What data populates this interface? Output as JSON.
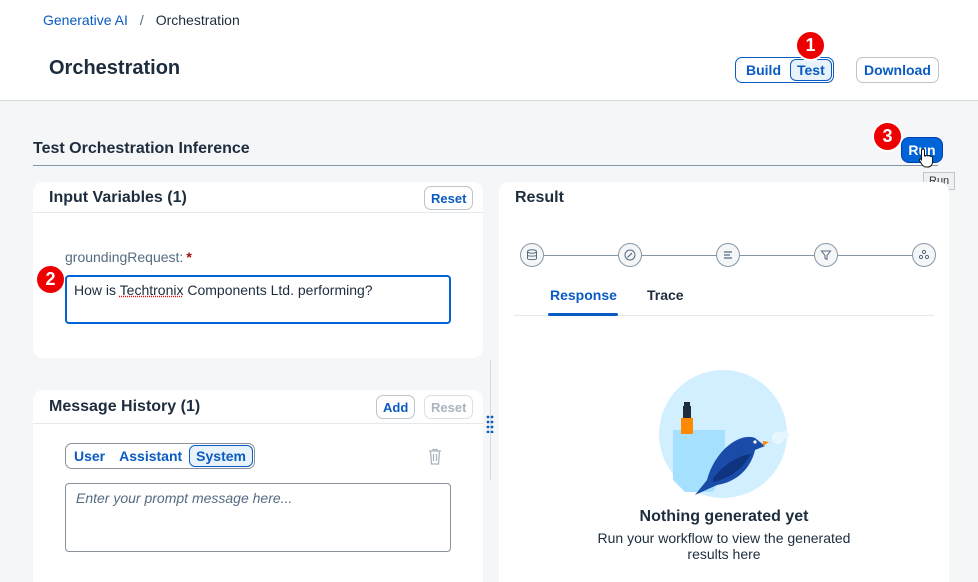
{
  "breadcrumb": {
    "parent": "Generative AI",
    "separator": "/",
    "current": "Orchestration"
  },
  "page_title": "Orchestration",
  "mode_toggle": {
    "build": "Build",
    "test": "Test",
    "active": "Test"
  },
  "download_label": "Download",
  "badges": {
    "b1": "1",
    "b2": "2",
    "b3": "3"
  },
  "section": {
    "title": "Test Orchestration Inference",
    "run_label": "Run",
    "run_tooltip": "Run"
  },
  "input_variables": {
    "title": "Input Variables (1)",
    "reset_label": "Reset",
    "field_label": "groundingRequest:",
    "required_mark": "*",
    "value_prefix": "How is ",
    "value_misspelled": "Techtronix",
    "value_suffix": " Components Ltd. performing?"
  },
  "message_history": {
    "title": "Message History (1)",
    "add_label": "Add",
    "reset_label": "Reset",
    "roles": [
      "User",
      "Assistant",
      "System"
    ],
    "active_role": "System",
    "prompt_placeholder": "Enter your prompt message here..."
  },
  "result": {
    "title": "Result",
    "tabs": [
      "Response",
      "Trace"
    ],
    "active_tab": "Response",
    "empty_title": "Nothing generated yet",
    "empty_text": "Run your workflow to view the generated results here",
    "flow_icons": [
      "database-icon",
      "edit-icon",
      "list-icon",
      "filter-icon",
      "settings-icon"
    ]
  },
  "colors": {
    "accent": "#0a5bc2",
    "primary_button": "#0064d9",
    "badge": "#ee0000",
    "illustration_blue": "#1a4ba8"
  }
}
